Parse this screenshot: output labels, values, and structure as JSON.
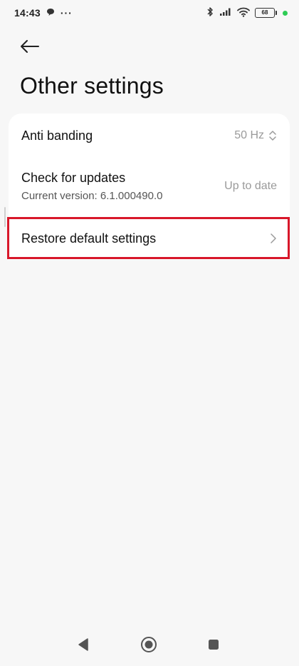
{
  "status_bar": {
    "time": "14:43",
    "more": "···",
    "battery": "68"
  },
  "header": {
    "title": "Other settings"
  },
  "settings": {
    "anti_banding": {
      "label": "Anti banding",
      "value": "50 Hz"
    },
    "check_updates": {
      "label": "Check for updates",
      "subtitle": "Current version: 6.1.000490.0",
      "value": "Up to date"
    },
    "restore": {
      "label": "Restore default settings"
    }
  },
  "colors": {
    "background": "#f7f7f7",
    "card": "#ffffff",
    "highlight": "#d8172a",
    "secondary_text": "#9a9a9a",
    "status_dot": "#2ecc55"
  },
  "icons": {
    "back": "arrow-left-icon",
    "anti_banding_value": "up-down-chevron-icon",
    "restore": "chevron-right-icon",
    "nav_back": "triangle-back-icon",
    "nav_home": "circle-home-icon",
    "nav_recents": "square-recents-icon"
  }
}
